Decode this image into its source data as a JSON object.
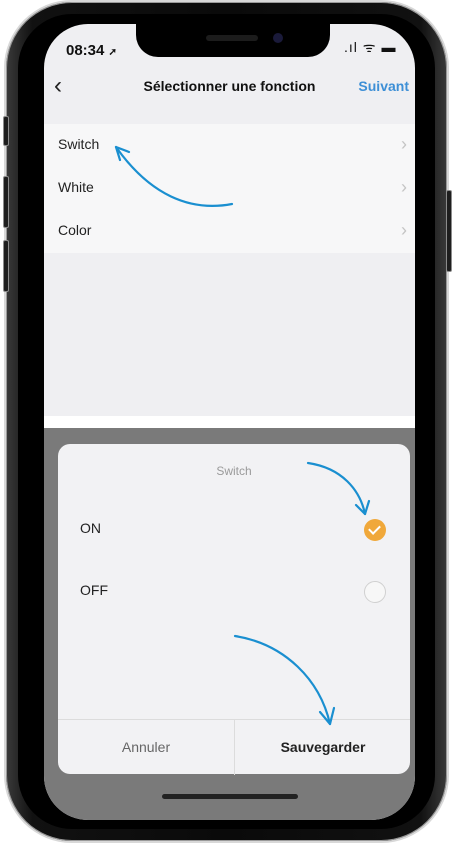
{
  "status_bar": {
    "time": "08:34",
    "location_glyph": "➚",
    "right_glyphs": ".ıl ᯤ ▬"
  },
  "nav": {
    "back_glyph": "‹",
    "title": "Sélectionner une fonction",
    "next_label": "Suivant"
  },
  "functions": [
    {
      "label": "Switch",
      "chevron": "›"
    },
    {
      "label": "White",
      "chevron": "›"
    },
    {
      "label": "Color",
      "chevron": "›"
    }
  ],
  "dialog": {
    "title": "Switch",
    "options": [
      {
        "label": "ON",
        "selected": true
      },
      {
        "label": "OFF",
        "selected": false
      }
    ],
    "cancel_label": "Annuler",
    "save_label": "Sauvegarder"
  },
  "colors": {
    "accent_blue": "#3d8fd6",
    "check_orange": "#f0a83a",
    "annotation_arrow": "#1a8fd0"
  },
  "icons": {
    "location": "location-arrow-icon",
    "signal": "signal-icon",
    "wifi": "wifi-icon",
    "battery": "battery-icon",
    "check": "check-icon"
  }
}
